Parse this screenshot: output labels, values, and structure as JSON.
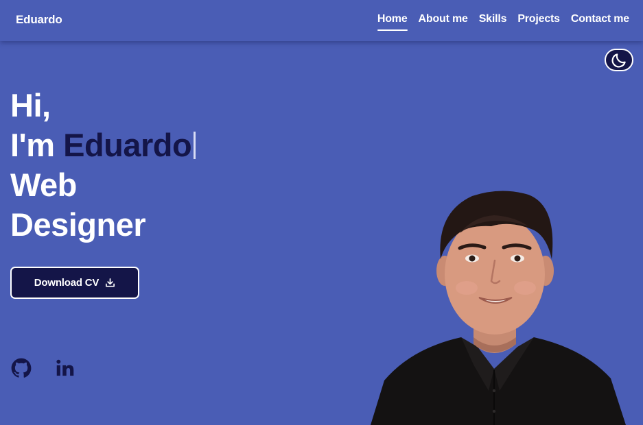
{
  "header": {
    "logo": "Eduardo",
    "nav": [
      {
        "label": "Home",
        "active": true
      },
      {
        "label": "About me",
        "active": false
      },
      {
        "label": "Skills",
        "active": false
      },
      {
        "label": "Projects",
        "active": false
      },
      {
        "label": "Contact me",
        "active": false
      }
    ]
  },
  "theme_toggle": {
    "icon": "moon-icon"
  },
  "hero": {
    "line1": "Hi,",
    "line2_prefix": "I'm ",
    "name": "Eduardo",
    "line3": "Web",
    "line4": "Designer",
    "download_label": "Download CV",
    "download_icon": "download-icon"
  },
  "social": [
    {
      "icon": "github-icon"
    },
    {
      "icon": "linkedin-icon"
    }
  ],
  "colors": {
    "background": "#4a5db5",
    "accent_dark": "#141548",
    "text": "#ffffff"
  }
}
